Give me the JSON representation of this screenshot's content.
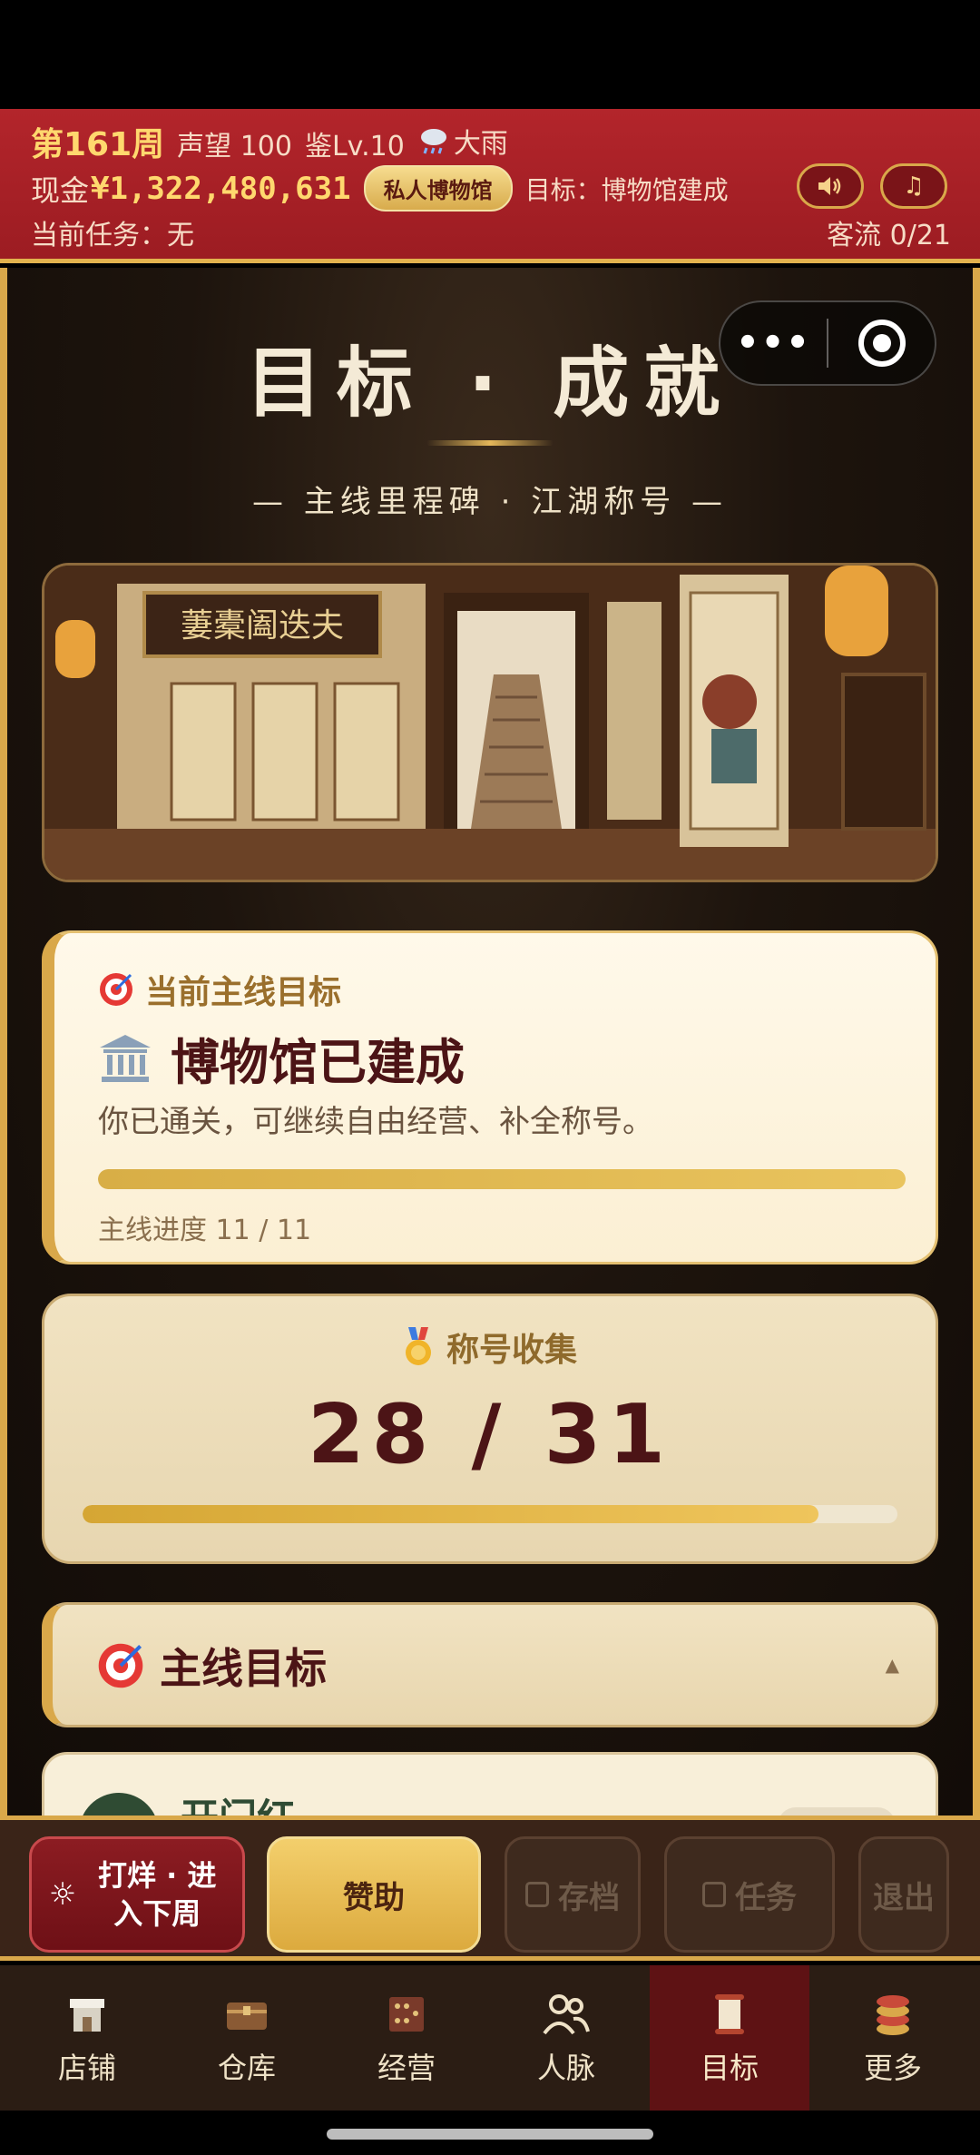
{
  "header": {
    "week": "第161周",
    "reputation": "声望 100",
    "appraisal_level": "鉴Lv.10",
    "weather_icon": "rain-cloud-icon",
    "weather": "大雨",
    "cash_label": "现金",
    "cash": "¥1,322,480,631",
    "museum_badge": "私人博物馆",
    "goal": "目标：博物馆建成",
    "sound_icon": "speaker-icon",
    "music_icon": "music-note-icon",
    "current_task": "当前任务：无",
    "visitor_flow": "客流 0/21"
  },
  "page": {
    "title": "目标 · 成就",
    "subtitle": "— 主线里程碑 · 江湖称号 —"
  },
  "capsule": {
    "more": "•••"
  },
  "main_goal_card": {
    "label_icon": "target-icon",
    "label": "当前主线目标",
    "title_icon": "museum-icon",
    "title": "博物馆已建成",
    "description": "你已通关，可继续自由经营、补全称号。",
    "progress_text": "主线进度 11 / 11",
    "progress_fraction": 1.0
  },
  "titles_card": {
    "label_icon": "medal-icon",
    "label": "称号收集",
    "count": "28 / 31",
    "collected": 28,
    "total": 31
  },
  "main_goals_section": {
    "icon": "target-icon",
    "title": "主线目标",
    "caret": "▲"
  },
  "peek_item": {
    "title": "开门红"
  },
  "action_bar": {
    "next_week": "打烊 · 进入下周",
    "sponsor": "赞助",
    "save": "存档",
    "tasks": "任务",
    "exit": "退出"
  },
  "tabs": [
    {
      "label": "店铺",
      "icon": "shop-icon"
    },
    {
      "label": "仓库",
      "icon": "warehouse-chest-icon"
    },
    {
      "label": "经营",
      "icon": "abacus-icon"
    },
    {
      "label": "人脉",
      "icon": "people-icon"
    },
    {
      "label": "目标",
      "icon": "scroll-icon",
      "active": true
    },
    {
      "label": "更多",
      "icon": "coin-stack-icon"
    }
  ],
  "colors": {
    "header_red": "#9c1c22",
    "gold": "#d9a84a",
    "dark_brown": "#2b1d14",
    "maroon_text": "#4c1416",
    "active_tab": "#5e1214"
  }
}
